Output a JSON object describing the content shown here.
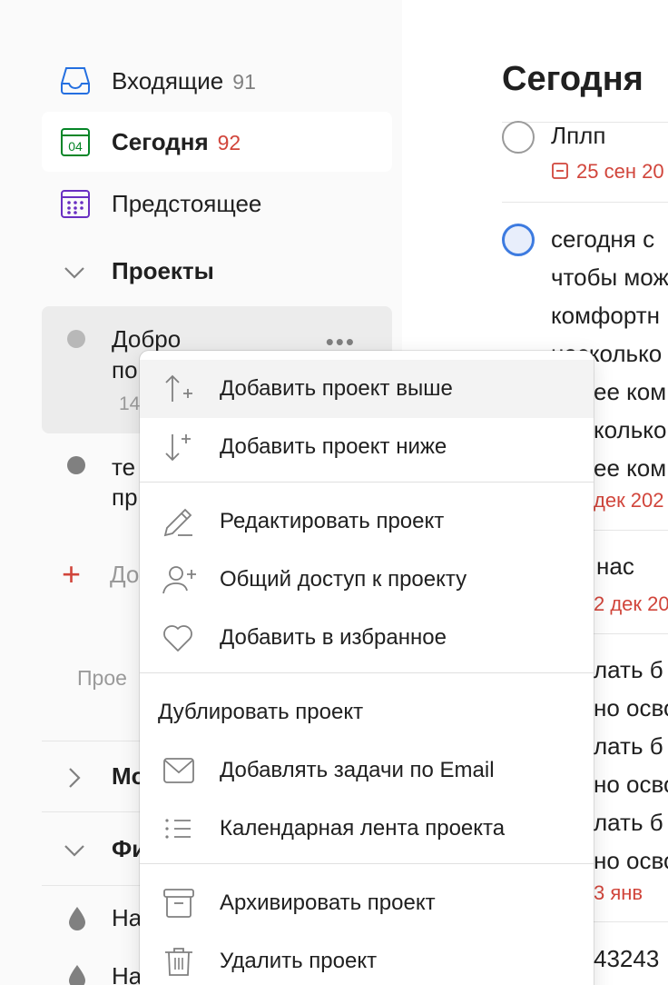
{
  "sidebar": {
    "nav": [
      {
        "label": "Входящие",
        "count": "91",
        "icon": "inbox-icon",
        "color": "#246fe0"
      },
      {
        "label": "Сегодня",
        "count": "92",
        "icon": "calendar-today-icon",
        "color": "#058527",
        "icon_text": "04"
      },
      {
        "label": "Предстоящее",
        "icon": "calendar-upcoming-icon",
        "color": "#692fc2"
      }
    ],
    "projects_header": "Проекты",
    "projects": [
      {
        "name_line1": "Добро",
        "name_line2": "по",
        "count": "14"
      },
      {
        "name_line1": "те",
        "name_line2": "пр"
      }
    ],
    "more_label": "•••",
    "add_project_label": "До",
    "projects_hint": "Прое",
    "collapsed_section_label": "Мо",
    "filters_header": "Фи",
    "filters": [
      {
        "label": "На"
      },
      {
        "label": "На"
      }
    ]
  },
  "main": {
    "title": "Сегодня",
    "tasks": [
      {
        "text_lines": [
          "Лплп"
        ],
        "date": "25 сен 20"
      },
      {
        "text_lines": [
          "сегодня с",
          "чтобы мож",
          "комфортн",
          "несколько",
          "ее ком",
          "колько",
          "ее ком"
        ],
        "date": "дек 202"
      },
      {
        "text_lines": [
          "нас"
        ],
        "date": "2 дек 20"
      },
      {
        "text_lines": [
          "лать б",
          "но осво",
          "лать б",
          "но осво",
          "лать б",
          "но осво"
        ],
        "date": "3 янв"
      },
      {
        "text_lines": [
          "43243"
        ]
      }
    ]
  },
  "context_menu": {
    "items": [
      {
        "label": "Добавить проект выше",
        "icon": "arrow-up-plus-icon"
      },
      {
        "label": "Добавить проект ниже",
        "icon": "arrow-down-plus-icon"
      },
      {
        "label": "Редактировать проект",
        "icon": "pencil-icon"
      },
      {
        "label": "Общий доступ к проекту",
        "icon": "add-person-icon"
      },
      {
        "label": "Добавить в избранное",
        "icon": "heart-icon"
      },
      {
        "label": "Дублировать проект"
      },
      {
        "label": "Добавлять задачи по Email",
        "icon": "envelope-icon"
      },
      {
        "label": "Календарная лента проекта",
        "icon": "list-icon"
      },
      {
        "label": "Архивировать проект",
        "icon": "archive-icon"
      },
      {
        "label": "Удалить проект",
        "icon": "trash-icon"
      }
    ]
  },
  "colors": {
    "accent_red": "#d1453b",
    "project_dot_gray": "#b8b8b8",
    "project_dot_dark": "#808080",
    "task_circle_blue": "#3d7be0"
  }
}
